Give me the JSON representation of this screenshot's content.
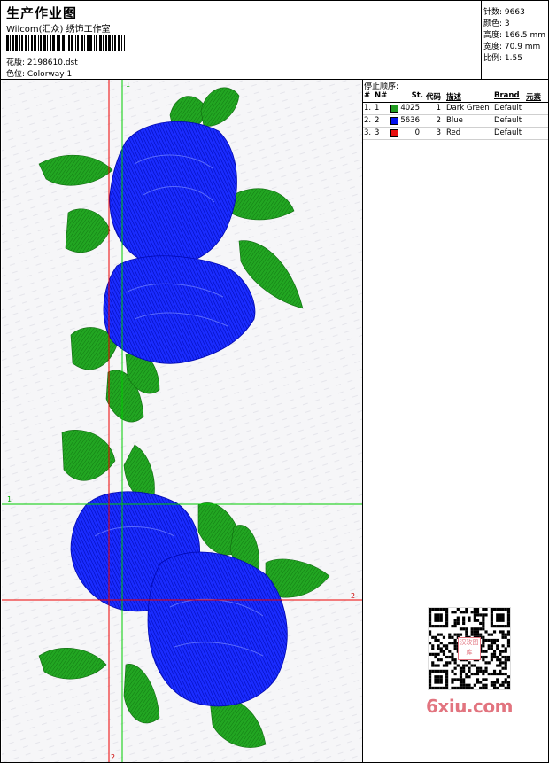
{
  "header": {
    "title": "生产作业图",
    "company": "Wilcom(汇众) 绣饰工作室",
    "pattern_file": "花版: 2198610.dst",
    "colorway": "色位: Colorway 1"
  },
  "stats": {
    "stitches": "针数: 9663",
    "colors": "颜色: 3",
    "height": "高度: 166.5 mm",
    "width": "宽度: 70.9 mm",
    "scale": "比例: 1.55"
  },
  "stop_sequence": {
    "title": "停止顺序:",
    "columns": {
      "num": "#",
      "no": "N#",
      "stitches": "St.",
      "code": "代码",
      "description": "描述",
      "brand": "Brand",
      "element": "元素"
    },
    "rows": [
      {
        "num": "1.",
        "no": "1",
        "color": "#1f9a1f",
        "stitches": "4025",
        "code": "1",
        "description": "Dark Green",
        "brand": "Default"
      },
      {
        "num": "2.",
        "no": "2",
        "color": "#0010ee",
        "stitches": "5636",
        "code": "2",
        "description": "Blue",
        "brand": "Default"
      },
      {
        "num": "3.",
        "no": "3",
        "color": "#e81010",
        "stitches": "0",
        "code": "3",
        "description": "Red",
        "brand": "Default"
      }
    ]
  },
  "axes": {
    "green_v_label": "1",
    "green_h_label": "1",
    "red_h_label": "2",
    "red_v_label": "2"
  },
  "watermark": {
    "text": "6xiu.com",
    "qr_center": "汉玫图库"
  },
  "colors": {
    "leaf": "#1f9a1f",
    "rose": "#0010ee",
    "guide_green": "#00cc00",
    "guide_red": "#ee0000"
  }
}
